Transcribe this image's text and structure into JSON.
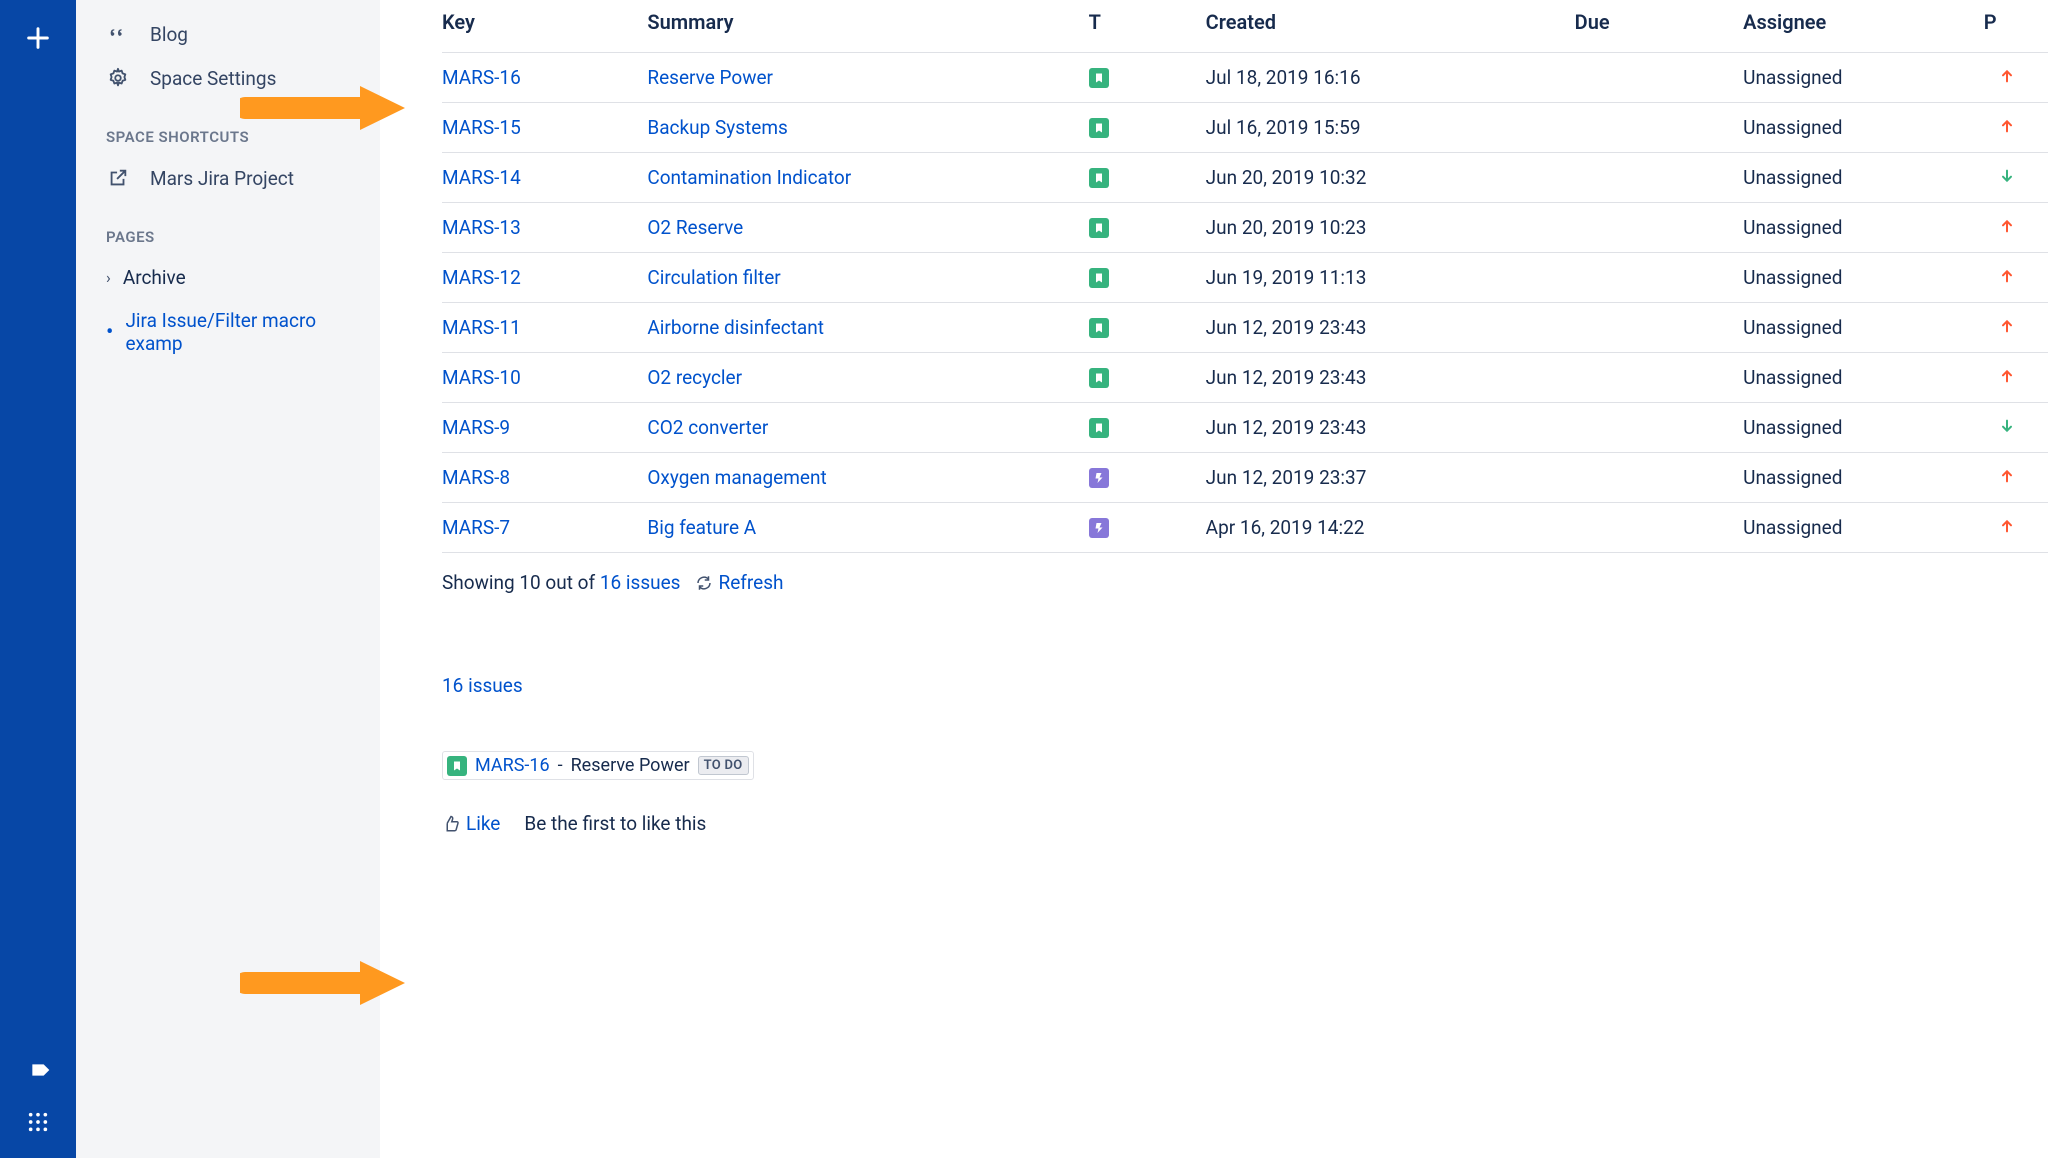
{
  "rail": {
    "plus": "plus",
    "notif": "notif",
    "apps": "apps"
  },
  "sidebar": {
    "blog": "Blog",
    "settings": "Space Settings",
    "shortcuts_heading": "SPACE SHORTCUTS",
    "shortcut_label": "Mars Jira Project",
    "pages_heading": "PAGES",
    "archive": "Archive",
    "current_page": "Jira Issue/Filter macro examp"
  },
  "table": {
    "headers": {
      "key": "Key",
      "summary": "Summary",
      "t": "T",
      "created": "Created",
      "due": "Due",
      "assignee": "Assignee",
      "p": "P"
    },
    "rows": [
      {
        "key": "MARS-16",
        "summary": "Reserve Power",
        "type": "story",
        "created": "Jul 18, 2019 16:16",
        "assignee": "Unassigned",
        "priority": "up"
      },
      {
        "key": "MARS-15",
        "summary": "Backup Systems",
        "type": "story",
        "created": "Jul 16, 2019 15:59",
        "assignee": "Unassigned",
        "priority": "up"
      },
      {
        "key": "MARS-14",
        "summary": "Contamination Indicator",
        "type": "story",
        "created": "Jun 20, 2019 10:32",
        "assignee": "Unassigned",
        "priority": "down"
      },
      {
        "key": "MARS-13",
        "summary": "O2 Reserve",
        "type": "story",
        "created": "Jun 20, 2019 10:23",
        "assignee": "Unassigned",
        "priority": "up"
      },
      {
        "key": "MARS-12",
        "summary": "Circulation filter",
        "type": "story",
        "created": "Jun 19, 2019 11:13",
        "assignee": "Unassigned",
        "priority": "up"
      },
      {
        "key": "MARS-11",
        "summary": "Airborne disinfectant",
        "type": "story",
        "created": "Jun 12, 2019 23:43",
        "assignee": "Unassigned",
        "priority": "up"
      },
      {
        "key": "MARS-10",
        "summary": "O2 recycler",
        "type": "story",
        "created": "Jun 12, 2019 23:43",
        "assignee": "Unassigned",
        "priority": "up"
      },
      {
        "key": "MARS-9",
        "summary": "CO2 converter",
        "type": "story",
        "created": "Jun 12, 2019 23:43",
        "assignee": "Unassigned",
        "priority": "down"
      },
      {
        "key": "MARS-8",
        "summary": "Oxygen management",
        "type": "epic",
        "created": "Jun 12, 2019 23:37",
        "assignee": "Unassigned",
        "priority": "up"
      },
      {
        "key": "MARS-7",
        "summary": "Big feature A",
        "type": "epic",
        "created": "Apr 16, 2019 14:22",
        "assignee": "Unassigned",
        "priority": "up"
      }
    ]
  },
  "footer": {
    "showing_prefix": "Showing 10 out of ",
    "issues_link": "16 issues",
    "refresh": "Refresh"
  },
  "summary_count": "16 issues",
  "single_issue": {
    "key": "MARS-16",
    "sep": " - ",
    "title": "Reserve Power",
    "status": "TO DO"
  },
  "like": {
    "label": "Like",
    "prompt": "Be the first to like this"
  }
}
